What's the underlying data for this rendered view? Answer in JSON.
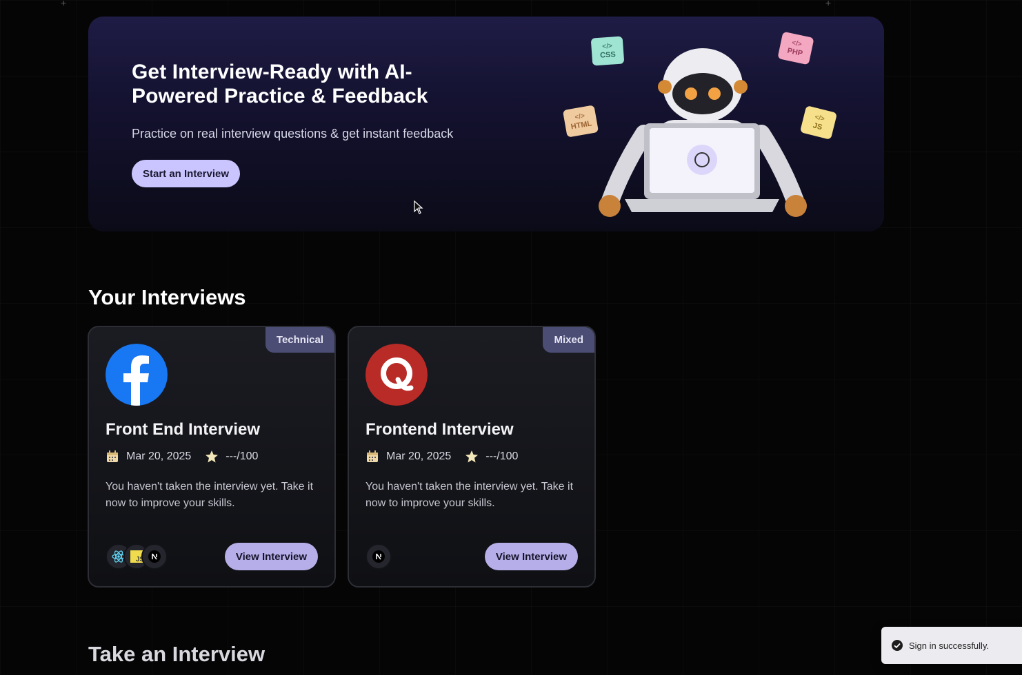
{
  "hero": {
    "title": "Get Interview-Ready with AI-Powered Practice & Feedback",
    "subtitle": "Practice on real interview questions & get instant feedback",
    "cta_label": "Start an Interview",
    "tags": [
      "CSS",
      "PHP",
      "HTML",
      "JS"
    ]
  },
  "interviews": {
    "section_title": "Your Interviews",
    "cards": [
      {
        "type_badge": "Technical",
        "title": "Front End Interview",
        "date": "Mar 20, 2025",
        "score": "---/100",
        "description": "You haven't taken the interview yet. Take it now to improve your skills.",
        "techs": [
          "react-icon",
          "javascript-icon",
          "nextjs-icon"
        ],
        "button_label": "View Interview",
        "company_icon": "facebook-icon"
      },
      {
        "type_badge": "Mixed",
        "title": "Frontend Interview",
        "date": "Mar 20, 2025",
        "score": "---/100",
        "description": "You haven't taken the interview yet. Take it now to improve your skills.",
        "techs": [
          "nextjs-icon"
        ],
        "button_label": "View Interview",
        "company_icon": "quora-icon"
      }
    ]
  },
  "take_section": {
    "title": "Take an Interview"
  },
  "toast": {
    "message": "Sign in successfully."
  },
  "colors": {
    "accent": "#cac5fe",
    "badge": "#4b4d74",
    "button": "#b5aee8"
  }
}
